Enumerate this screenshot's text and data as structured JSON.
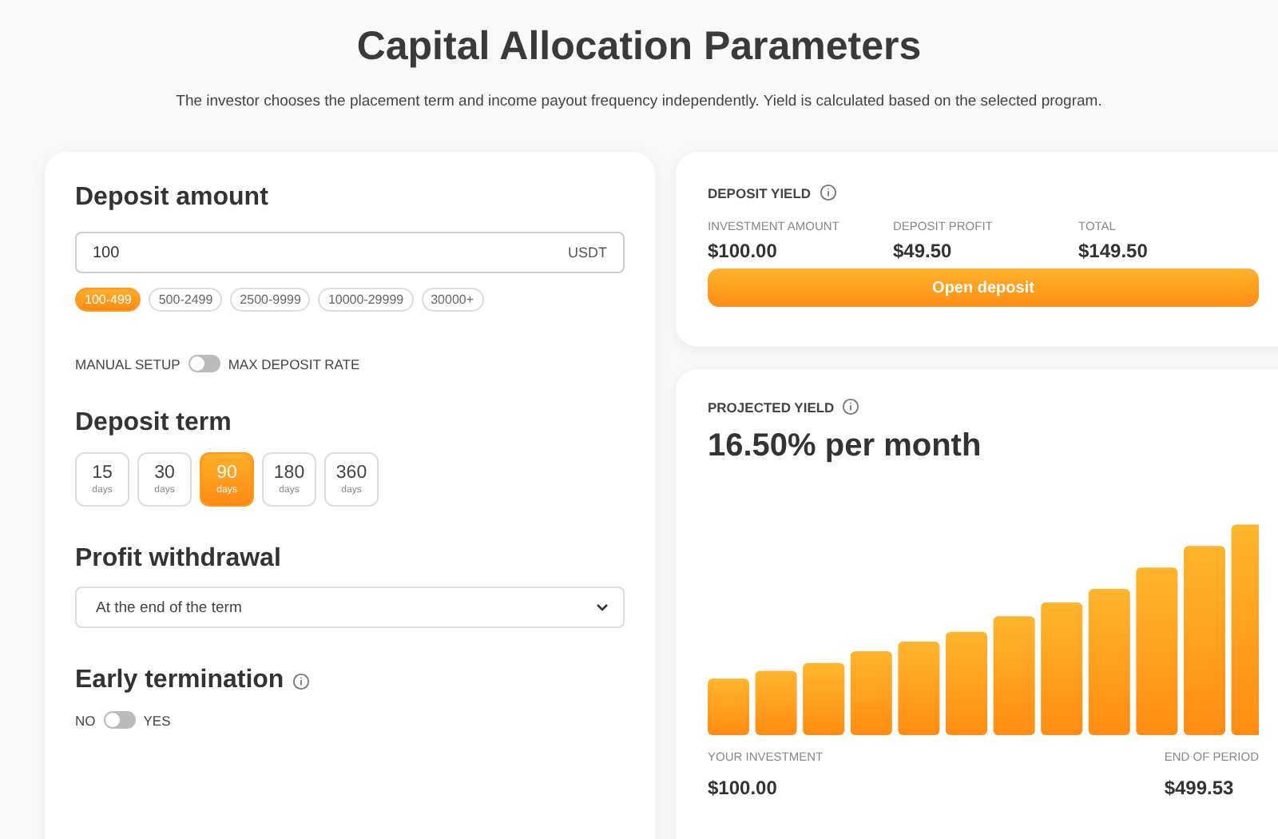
{
  "header": {
    "title": "Capital Allocation Parameters",
    "subtitle": "The investor chooses the placement term and income payout frequency independently. Yield is calculated based on the selected program."
  },
  "deposit_amount": {
    "heading": "Deposit amount",
    "value": "100",
    "currency": "USDT",
    "ranges": [
      {
        "label": "100-499",
        "selected": true
      },
      {
        "label": "500-2499",
        "selected": false
      },
      {
        "label": "2500-9999",
        "selected": false
      },
      {
        "label": "10000-29999",
        "selected": false
      },
      {
        "label": "30000+",
        "selected": false
      }
    ],
    "mode_toggle": {
      "left_label": "MANUAL SETUP",
      "right_label": "MAX DEPOSIT RATE",
      "on": false
    }
  },
  "deposit_term": {
    "heading": "Deposit term",
    "options": [
      {
        "value": "15",
        "unit": "days",
        "selected": false
      },
      {
        "value": "30",
        "unit": "days",
        "selected": false
      },
      {
        "value": "90",
        "unit": "days",
        "selected": true
      },
      {
        "value": "180",
        "unit": "days",
        "selected": false
      },
      {
        "value": "360",
        "unit": "days",
        "selected": false
      }
    ]
  },
  "profit_withdrawal": {
    "heading": "Profit withdrawal",
    "value": "At the end of the term"
  },
  "early_termination": {
    "heading": "Early termination",
    "left_label": "NO",
    "right_label": "YES",
    "on": false
  },
  "deposit_yield": {
    "label": "DEPOSIT YIELD",
    "stats": [
      {
        "label": "INVESTMENT AMOUNT",
        "value": "$100.00"
      },
      {
        "label": "DEPOSIT PROFIT",
        "value": "$49.50"
      },
      {
        "label": "TOTAL",
        "value": "$149.50"
      }
    ],
    "button": "Open deposit"
  },
  "projected_yield": {
    "label": "PROJECTED YIELD",
    "rate": "16.50% per month",
    "start_label": "YOUR INVESTMENT",
    "start_value": "$100.00",
    "end_label": "END OF PERIOD",
    "end_value": "$499.53"
  }
}
